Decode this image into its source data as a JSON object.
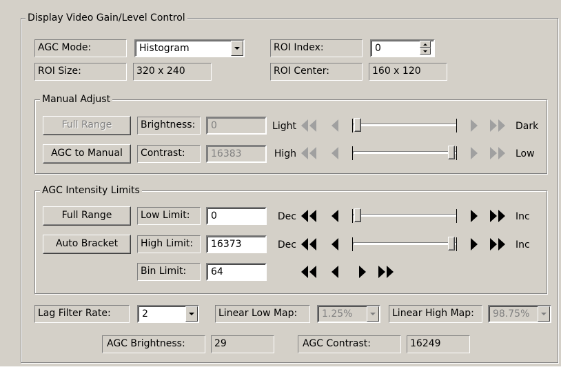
{
  "group_title": "Display Video Gain/Level Control",
  "agc_mode": {
    "label": "AGC Mode:",
    "value": "Histogram"
  },
  "roi_index": {
    "label": "ROI Index:",
    "value": "0"
  },
  "roi_size": {
    "label": "ROI Size:",
    "value": "320 x 240"
  },
  "roi_center": {
    "label": "ROI Center:",
    "value": "160 x 120"
  },
  "manual_adjust": {
    "title": "Manual Adjust",
    "full_range_button": "Full Range",
    "agc_to_manual_button": "AGC to Manual",
    "brightness": {
      "label": "Brightness:",
      "value": "0",
      "left": "Light",
      "right": "Dark",
      "level": 0.0
    },
    "contrast": {
      "label": "Contrast:",
      "value": "16383",
      "left": "High",
      "right": "Low",
      "level": 1.0
    }
  },
  "agc_limits": {
    "title": "AGC Intensity Limits",
    "full_range_button": "Full Range",
    "auto_bracket_button": "Auto Bracket",
    "low_limit": {
      "label": "Low Limit:",
      "value": "0",
      "left": "Dec",
      "right": "Inc",
      "level": 0.0
    },
    "high_limit": {
      "label": "High Limit:",
      "value": "16373",
      "left": "Dec",
      "right": "Inc",
      "level": 1.0
    },
    "bin_limit": {
      "label": "Bin Limit:",
      "value": "64"
    }
  },
  "lag_filter": {
    "label": "Lag Filter Rate:",
    "value": "2"
  },
  "linear_low": {
    "label": "Linear Low Map:",
    "value": "1.25%"
  },
  "linear_high": {
    "label": "Linear High Map:",
    "value": "98.75%"
  },
  "agc_brightness": {
    "label": "AGC Brightness:",
    "value": "29"
  },
  "agc_contrast": {
    "label": "AGC Contrast:",
    "value": "16249"
  },
  "colors": {
    "face": "#d4d0c8",
    "disabled_text": "#808080"
  },
  "icons": [
    "chevron-down-icon",
    "spin-up-icon",
    "spin-down-icon",
    "double-left-arrow-icon",
    "left-arrow-icon",
    "right-arrow-icon",
    "double-right-arrow-icon"
  ]
}
